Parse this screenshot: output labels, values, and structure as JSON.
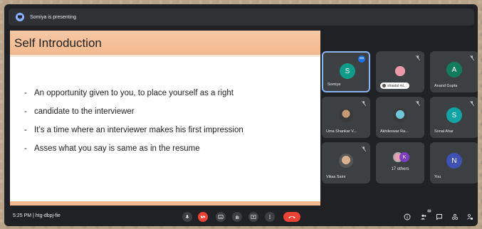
{
  "presenting_bar": {
    "text": "Somiya is presenting"
  },
  "slide": {
    "title": "Self Introduction",
    "bullets": [
      "An opportunity given to you, to place yourself as a right",
      "candidate to the interviewer",
      "It’s a time where an interviewer makes his first impression",
      "Asses what you say is same as in the resume"
    ]
  },
  "participants": [
    {
      "name": "Somiya",
      "initial": "S",
      "color": "#0f9d8a"
    },
    {
      "name": "shaatal mi...",
      "type": "photo"
    },
    {
      "name": "Anand Gupta",
      "initial": "A",
      "color": "#137c5c"
    },
    {
      "name": "Uma Shankar V...",
      "type": "photo"
    },
    {
      "name": "Akhileswar Ra...",
      "type": "photo"
    },
    {
      "name": "Sonal Ahar",
      "initial": "S",
      "color": "#12a4a4"
    },
    {
      "name": "Vikas Saini",
      "type": "photo"
    },
    {
      "name": "17 others",
      "initial": "K",
      "color": "#7b3fbf"
    },
    {
      "name": "You",
      "initial": "N",
      "color": "#3f51b5"
    }
  ],
  "toolbar": {
    "meeting_info": "5:25 PM  |  htg-dbpj-fie",
    "people_badge": "24"
  },
  "colors": {
    "accent": "#8ab4f8",
    "end_call": "#ea4335"
  }
}
